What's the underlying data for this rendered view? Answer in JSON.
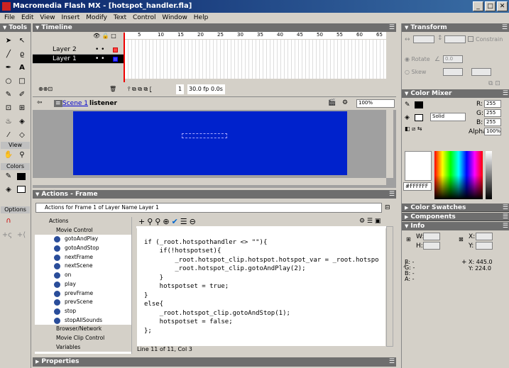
{
  "window": {
    "title": "Macromedia Flash MX - [hotspot_handler.fla]"
  },
  "menu": [
    "File",
    "Edit",
    "View",
    "Insert",
    "Modify",
    "Text",
    "Control",
    "Window",
    "Help"
  ],
  "tools": {
    "title": "Tools",
    "view_label": "View",
    "colors_label": "Colors",
    "options_label": "Options"
  },
  "timeline": {
    "title": "Timeline",
    "layers": [
      "Layer 2",
      "Layer 1"
    ],
    "ruler": [
      "5",
      "10",
      "15",
      "20",
      "25",
      "30",
      "35",
      "40",
      "45",
      "50",
      "55",
      "60",
      "65"
    ],
    "frame": "1",
    "fps": "30.0 fps",
    "time": "0.0s"
  },
  "scene": {
    "scene_label": "Scene 1",
    "symbol_label": "listener",
    "zoom": "100%"
  },
  "actions": {
    "title": "Actions - Frame",
    "header": "Actions for Frame 1 of Layer Name Layer 1",
    "status": "Line 11 of 11, Col 3",
    "tree": {
      "root": "Actions",
      "movie_control": "Movie Control",
      "items": [
        "gotoAndPlay",
        "gotoAndStop",
        "nextFrame",
        "nextScene",
        "on",
        "play",
        "prevFrame",
        "prevScene",
        "stop",
        "stopAllSounds"
      ],
      "categories": [
        "Browser/Network",
        "Movie Clip Control",
        "Variables"
      ]
    },
    "code": [
      "if (_root.hotspothandler <> \"\"){",
      "    if(!hotspotset){",
      "        _root.hotspot_clip.hotspot.hotspot_var = _root.hotspo",
      "        _root.hotspot_clip.gotoAndPlay(2);",
      "    }",
      "    hotspotset = true;",
      "}",
      "else{",
      "    _root.hotspot_clip.gotoAndStop(1);",
      "    hotspotset = false;",
      "};"
    ]
  },
  "properties": {
    "title": "Properties"
  },
  "transform": {
    "title": "Transform",
    "constrain": "Constrain",
    "rotate": "Rotate",
    "skew": "Skew",
    "rot_val": "0.0"
  },
  "color_mixer": {
    "title": "Color Mixer",
    "r_label": "R:",
    "g_label": "G:",
    "b_label": "B:",
    "r": "255",
    "g": "255",
    "b": "255",
    "fill_type": "Solid",
    "alpha_label": "Alpha:",
    "alpha": "100%",
    "hex": "#FFFFFF"
  },
  "panels": {
    "swatches": "Color Swatches",
    "components": "Components",
    "info": "Info"
  },
  "info": {
    "w": "W:",
    "h": "H:",
    "x": "X:",
    "y": "Y:",
    "r": "R: -",
    "g": "G: -",
    "b": "B: -",
    "a": "A: -",
    "mx": "X: 445.0",
    "my": "Y: 224.0"
  }
}
